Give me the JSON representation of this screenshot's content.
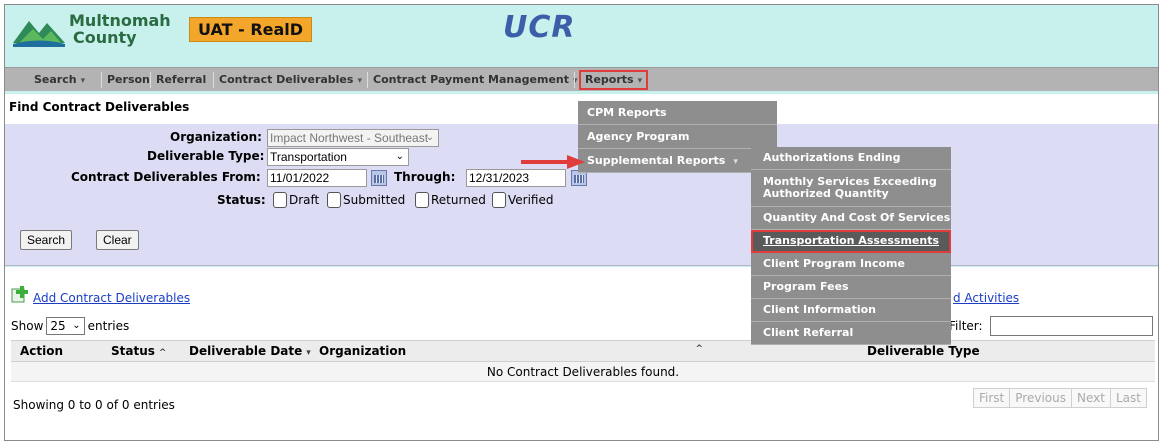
{
  "header": {
    "logo_line1": "Multnomah",
    "logo_line2": "County",
    "env_badge": "UAT - RealD",
    "app_title": "UCR"
  },
  "nav": {
    "items": [
      {
        "label": "Search",
        "has_caret": true
      },
      {
        "label": "Person",
        "has_caret": false
      },
      {
        "label": "Referral",
        "has_caret": false
      },
      {
        "label": "Contract Deliverables",
        "has_caret": true
      },
      {
        "label": "Contract Payment Management",
        "has_caret": true
      },
      {
        "label": "Reports",
        "has_caret": true
      }
    ],
    "caret": "▾"
  },
  "page_title": "Find Contract Deliverables",
  "form": {
    "organization_label": "Organization:",
    "organization_value": "Impact Northwest - Southeast",
    "deliverable_type_label": "Deliverable Type:",
    "deliverable_type_value": "Transportation",
    "from_label": "Contract Deliverables From:",
    "from_value": "11/01/2022",
    "through_label": "Through:",
    "through_value": "12/31/2023",
    "status_label": "Status:",
    "statuses": [
      "Draft",
      "Submitted",
      "Returned",
      "Verified"
    ],
    "search_button": "Search",
    "clear_button": "Clear"
  },
  "results": {
    "add_link": "Add Contract Deliverables",
    "right_link": "d Activities",
    "show_label": "Show",
    "show_value": "25",
    "entries_label": "entries",
    "filter_label": "Filter:",
    "columns": [
      "Action",
      "Status",
      "Deliverable Date",
      "Organization",
      "Deliverable Type"
    ],
    "empty_message": "No Contract Deliverables found.",
    "showing_text": "Showing 0 to 0 of 0 entries",
    "pager": [
      "First",
      "Previous",
      "Next",
      "Last"
    ]
  },
  "reports_menu": {
    "items": [
      "CPM Reports",
      "Agency Program",
      "Supplemental Reports"
    ]
  },
  "supplemental_menu": {
    "items": [
      "Authorizations Ending",
      "Monthly Services Exceeding Authorized Quantity",
      "Quantity And Cost Of Services",
      "Transportation Assessments",
      "Client Program Income",
      "Program Fees",
      "Client Information",
      "Client Referral"
    ],
    "active_index": 3
  },
  "colors": {
    "header_bg": "#c8f0ec",
    "badge": "#f4a62a",
    "title": "#3c5ea8",
    "highlight": "#e03c3c",
    "menu_bg": "#8e8e8e"
  }
}
